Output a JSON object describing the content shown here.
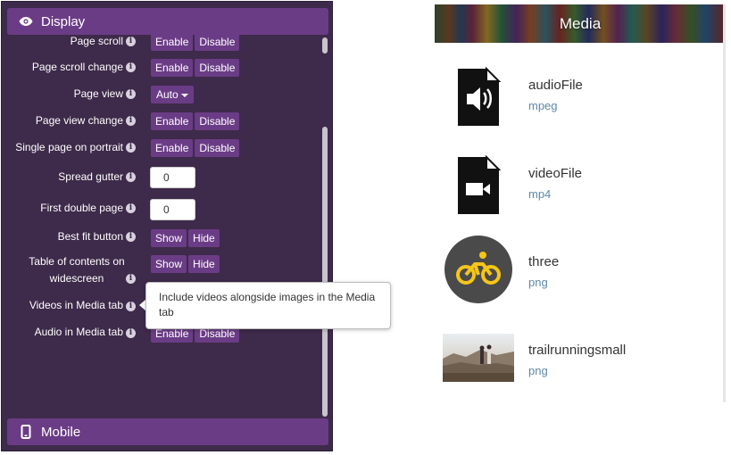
{
  "settings": {
    "display_header": "Display",
    "mobile_header": "Mobile",
    "rows": {
      "page_scroll": {
        "label": "Page scroll",
        "btn1": "Enable",
        "btn2": "Disable"
      },
      "page_scroll_change": {
        "label": "Page scroll change",
        "btn1": "Enable",
        "btn2": "Disable"
      },
      "page_view": {
        "label": "Page view",
        "value": "Auto"
      },
      "page_view_change": {
        "label": "Page view change",
        "btn1": "Enable",
        "btn2": "Disable"
      },
      "single_page_portrait": {
        "label": "Single page on portrait",
        "btn1": "Enable",
        "btn2": "Disable"
      },
      "spread_gutter": {
        "label": "Spread gutter",
        "value": "0"
      },
      "first_double_page": {
        "label": "First double page",
        "value": "0"
      },
      "best_fit_button": {
        "label": "Best fit button",
        "btn1": "Show",
        "btn2": "Hide"
      },
      "toc_widescreen": {
        "label": "Table of contents on widescreen",
        "btn1": "Show",
        "btn2": "Hide"
      },
      "videos_media_tab": {
        "label": "Videos in Media tab"
      },
      "audio_media_tab": {
        "label": "Audio in Media tab",
        "btn1": "Enable",
        "btn2": "Disable"
      }
    },
    "info_glyph": "i"
  },
  "tooltip": {
    "text": "Include videos alongside images in the Media tab"
  },
  "media": {
    "title": "Media",
    "items": [
      {
        "name": "audioFile",
        "type": "mpeg",
        "icon": "audio-file-icon"
      },
      {
        "name": "videoFile",
        "type": "mp4",
        "icon": "video-file-icon"
      },
      {
        "name": "three",
        "type": "png",
        "icon": "bicycle-icon"
      },
      {
        "name": "trailrunningsmall",
        "type": "png",
        "icon": "photo-thumbnail"
      }
    ]
  },
  "colors": {
    "panel_bg": "#3e2a4a",
    "accent": "#6b3c86",
    "link": "#5d8aa8"
  }
}
